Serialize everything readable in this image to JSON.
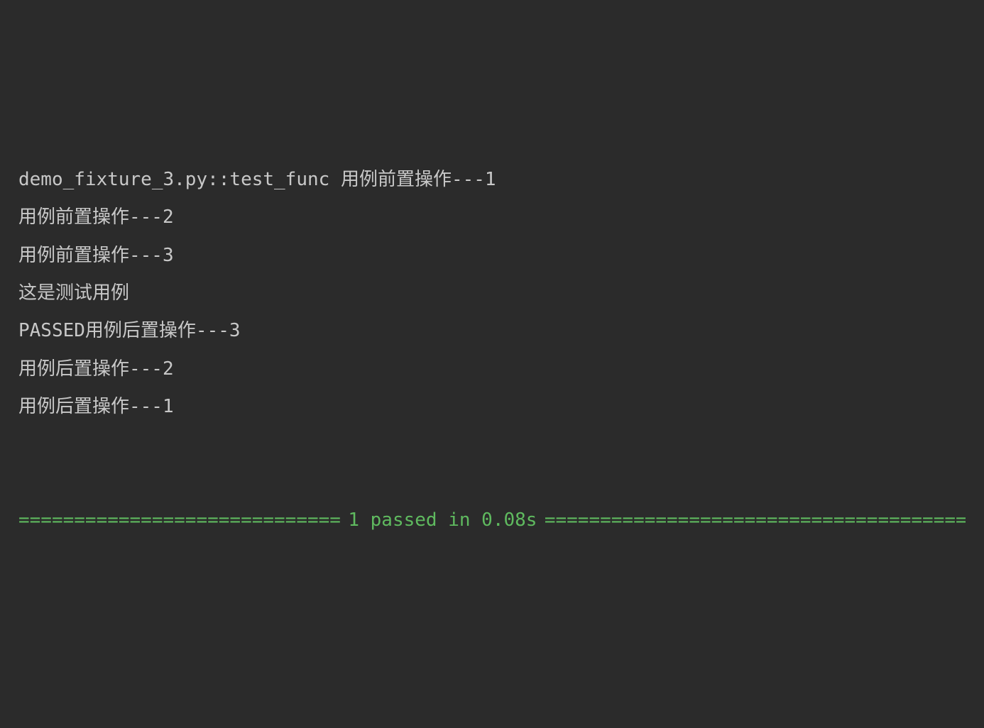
{
  "lines": {
    "l0": "demo_fixture_3.py::test_func 用例前置操作---1",
    "l1": "用例前置操作---2",
    "l2": "用例前置操作---3",
    "l3": "这是测试用例",
    "l4_status": "PASSED",
    "l4_rest": "用例后置操作---3",
    "l5": "用例后置操作---2",
    "l6": "用例后置操作---1"
  },
  "summary": {
    "rule_left": "=============================",
    "text": "1 passed in 0.08s",
    "rule_right": "==============================================================="
  }
}
